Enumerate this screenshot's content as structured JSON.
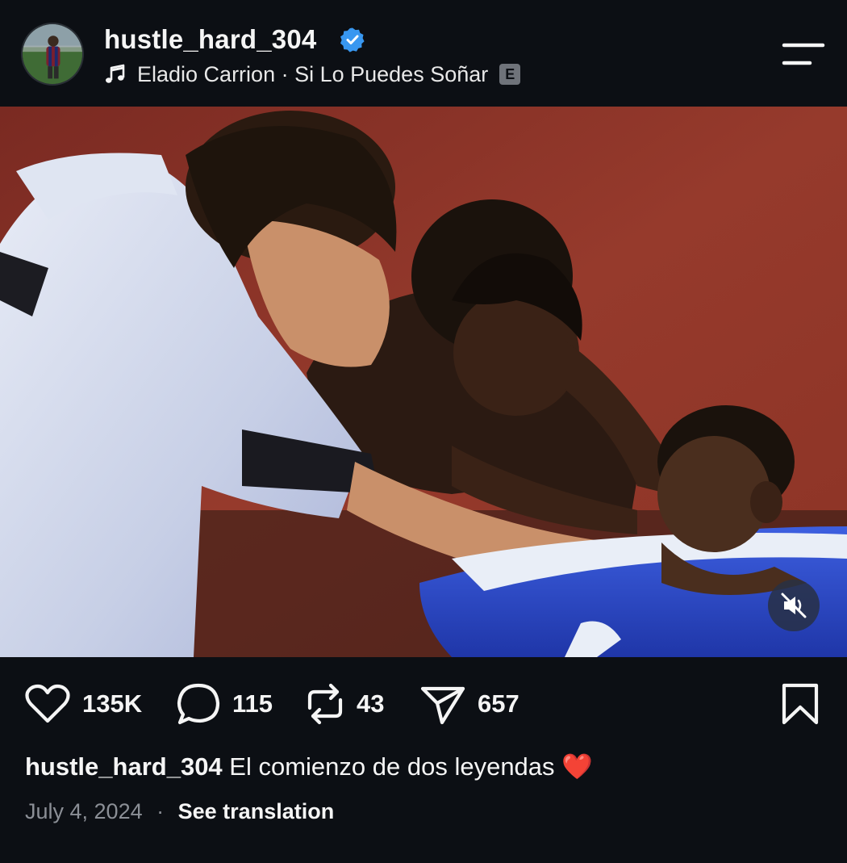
{
  "header": {
    "username": "hustle_hard_304",
    "verified": true,
    "music": {
      "icon": "music-note-icon",
      "text": "Eladio Carrion · Si Lo Puedes Soñar",
      "explicit_badge": "E"
    },
    "menu_icon": "hamburger-menu-icon"
  },
  "media": {
    "type": "video",
    "mute_icon": "speaker-muted-icon"
  },
  "actions": {
    "like": {
      "icon": "heart-icon",
      "count": "135K"
    },
    "comment": {
      "icon": "comment-icon",
      "count": "115"
    },
    "repost": {
      "icon": "repost-icon",
      "count": "43"
    },
    "share": {
      "icon": "send-icon",
      "count": "657"
    },
    "save": {
      "icon": "bookmark-icon"
    }
  },
  "caption": {
    "username": "hustle_hard_304",
    "text": "El comienzo de dos leyendas",
    "emoji": "❤️"
  },
  "meta": {
    "date": "July 4, 2024",
    "separator": "·",
    "translate_label": "See translation"
  },
  "colors": {
    "background": "#0c0f14",
    "verified": "#3897f0",
    "media_wall": "#8a2f25",
    "tub": "#2e4fd0"
  }
}
